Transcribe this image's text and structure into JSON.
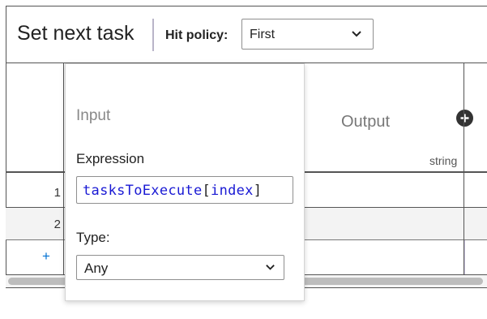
{
  "header": {
    "title": "Set next task",
    "hit_policy_label": "Hit policy:",
    "hit_policy_value": "First"
  },
  "table": {
    "output_label": "Output",
    "output_type": "string",
    "rows": [
      "1",
      "2"
    ],
    "add_row_label": "+"
  },
  "popover": {
    "section_label": "Input",
    "expression_label": "Expression",
    "expression_value": {
      "part1": "tasksToExecute",
      "part2": "[",
      "part3": "index",
      "part4": "]"
    },
    "type_label": "Type:",
    "type_value": "Any"
  },
  "icons": {
    "add_column": "plus-circle-icon",
    "dropdown": "chevron-down-icon"
  },
  "colors": {
    "expression_identifier": "#1a1ad4",
    "add_row": "#0070d2",
    "separator": "#b9b4c8"
  }
}
